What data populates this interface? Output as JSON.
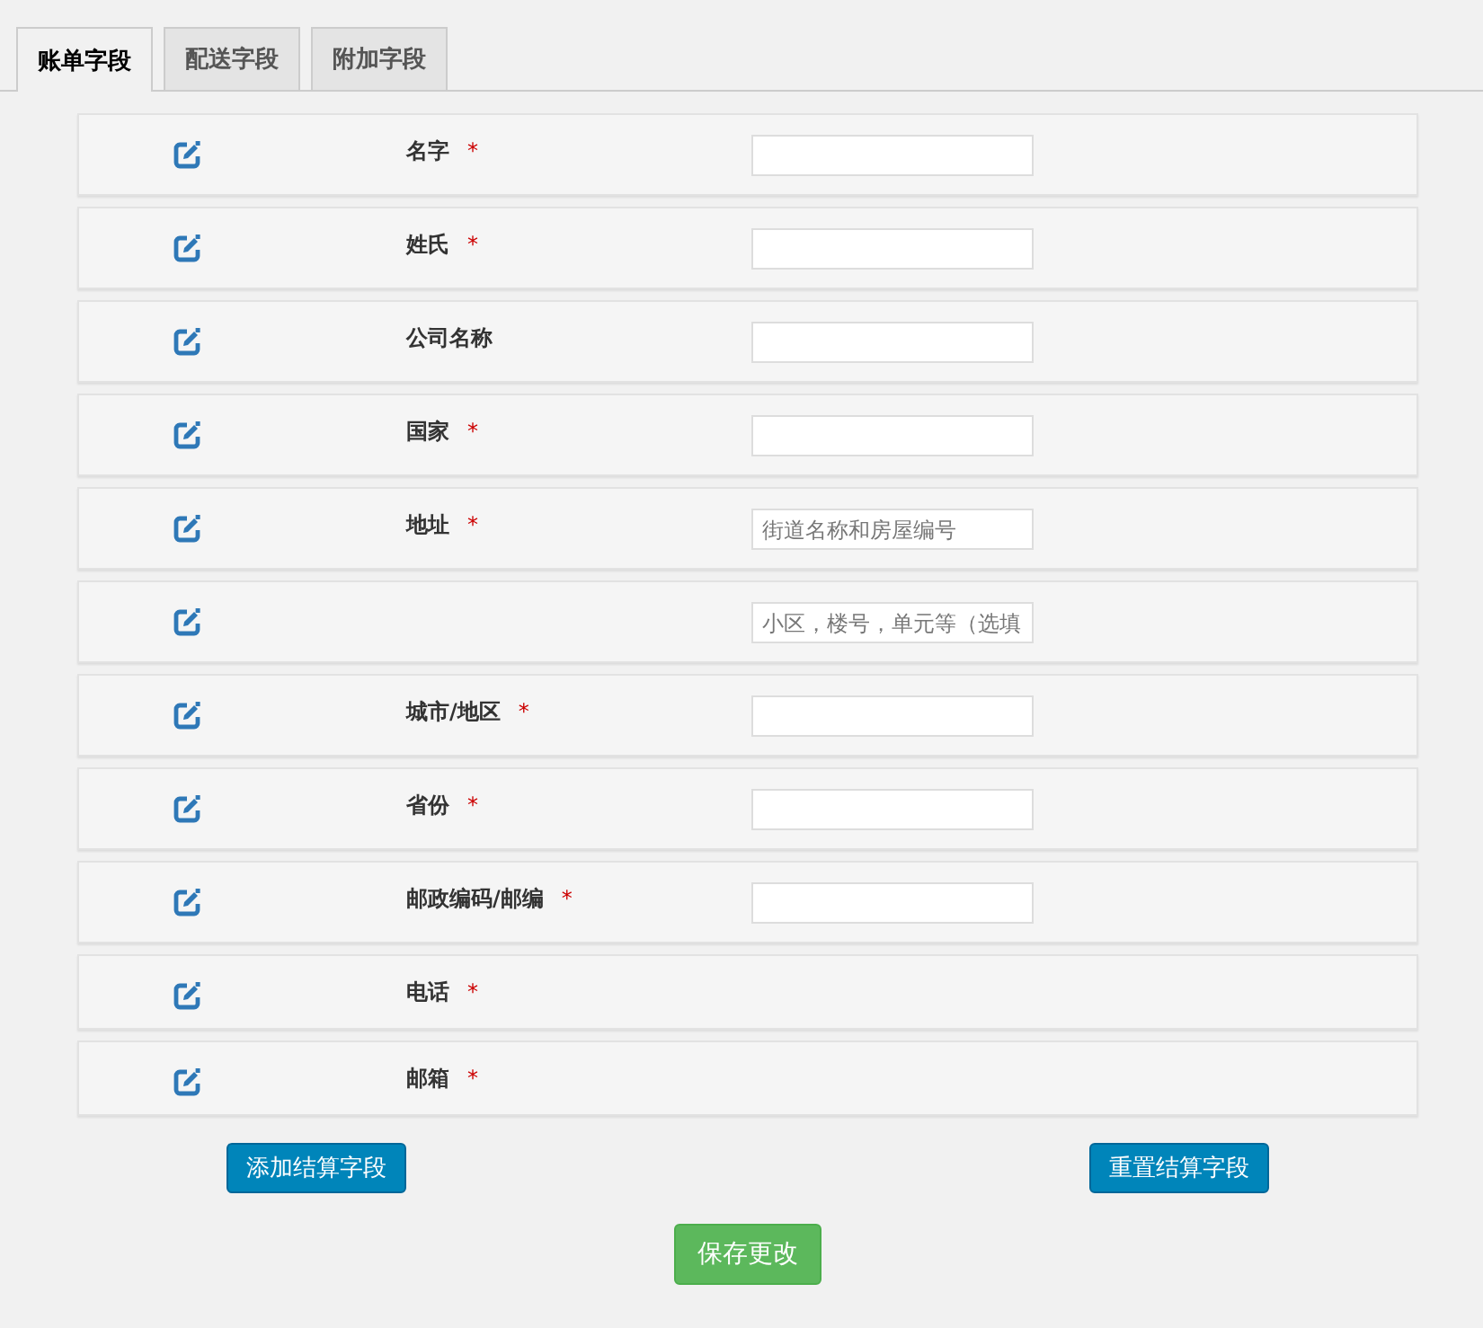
{
  "tabs": [
    {
      "label": "账单字段",
      "selected": true
    },
    {
      "label": "配送字段",
      "selected": false
    },
    {
      "label": "附加字段",
      "selected": false
    }
  ],
  "fields": [
    {
      "label": "名字",
      "required": true,
      "kind": "input"
    },
    {
      "label": "姓氏",
      "required": true,
      "kind": "input"
    },
    {
      "label": "公司名称",
      "required": false,
      "kind": "input"
    },
    {
      "label": "国家",
      "required": true,
      "kind": "input"
    },
    {
      "label": "地址",
      "required": true,
      "kind": "input",
      "placeholder": "街道名称和房屋编号"
    },
    {
      "kind": "input",
      "required": false,
      "placeholder": "小区，楼号，单元等（选填"
    },
    {
      "label": "城市/地区",
      "required": true,
      "kind": "input"
    },
    {
      "label": "省份",
      "required": true,
      "kind": "input"
    },
    {
      "label": "邮政编码/邮编",
      "required": true,
      "kind": "input"
    },
    {
      "label": "电话",
      "required": true,
      "kind": "none"
    },
    {
      "label": "邮箱",
      "required": true,
      "kind": "none"
    }
  ],
  "required_mark": "*",
  "buttons": {
    "add": "添加结算字段",
    "reset": "重置结算字段",
    "save": "保存更改"
  }
}
